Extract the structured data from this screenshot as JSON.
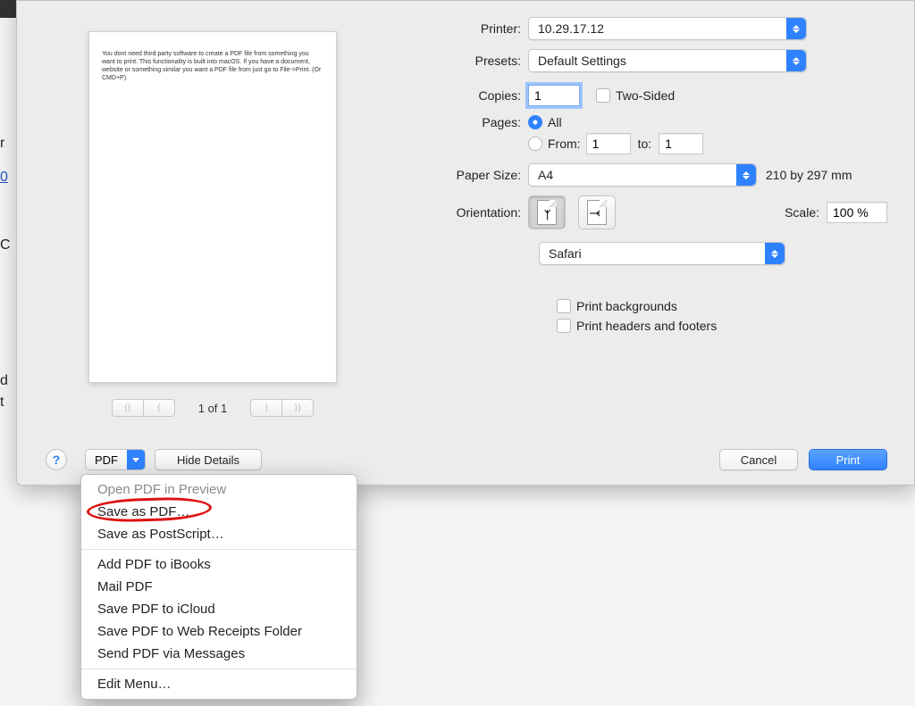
{
  "preview_text": "You dont need third party software to create a PDF file from something you want to print. This functionality is built into macOS. If you have a document, website or something similar you want a PDF file from just go to File->Print. (Or CMD+P).",
  "page_indicator": "1 of 1",
  "labels": {
    "printer": "Printer:",
    "presets": "Presets:",
    "copies": "Copies:",
    "pages": "Pages:",
    "paper_size": "Paper Size:",
    "orientation": "Orientation:",
    "scale": "Scale:",
    "two_sided": "Two-Sided",
    "all": "All",
    "from": "From:",
    "to": "to:",
    "paper_dims": "210 by 297 mm",
    "print_backgrounds": "Print backgrounds",
    "print_headers": "Print headers and footers"
  },
  "values": {
    "printer": "10.29.17.12",
    "presets": "Default Settings",
    "copies": "1",
    "from": "1",
    "to": "1",
    "paper_size": "A4",
    "app_select": "Safari",
    "scale": "100 %"
  },
  "buttons": {
    "pdf": "PDF",
    "hide_details": "Hide Details",
    "cancel": "Cancel",
    "print": "Print",
    "help": "?"
  },
  "pdf_menu": {
    "open_preview": "Open PDF in Preview",
    "save_as_pdf": "Save as PDF…",
    "save_as_ps": "Save as PostScript…",
    "ibooks": "Add PDF to iBooks",
    "mail": "Mail PDF",
    "icloud": "Save PDF to iCloud",
    "web_receipts": "Save PDF to Web Receipts Folder",
    "messages": "Send PDF via Messages",
    "edit_menu": "Edit Menu…"
  }
}
